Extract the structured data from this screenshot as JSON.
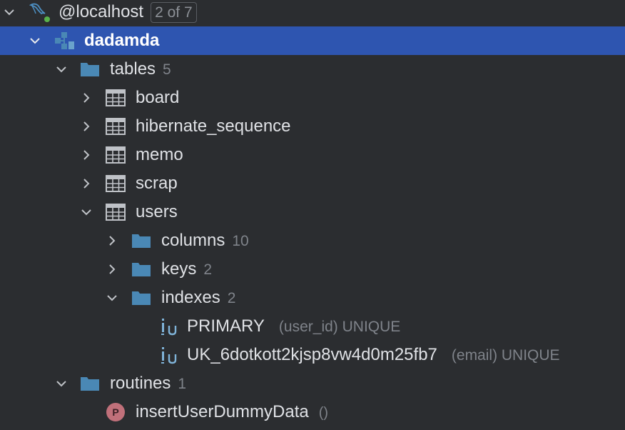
{
  "colors": {
    "background": "#2b2d30",
    "selection": "#2e55b0",
    "folder": "#4a88b5",
    "procedure": "#c0707a",
    "text": "#dfe1e5",
    "muted": "#7f838a"
  },
  "tree": {
    "host": {
      "label": "@localhost",
      "badge": "2 of 7",
      "icon": "mysql-dolphin-icon"
    },
    "schema": {
      "label": "dadamda",
      "icon": "schema-icon"
    },
    "tables": {
      "label": "tables",
      "count": "5",
      "icon": "folder-icon",
      "items": [
        {
          "label": "board",
          "icon": "table-icon"
        },
        {
          "label": "hibernate_sequence",
          "icon": "table-icon"
        },
        {
          "label": "memo",
          "icon": "table-icon"
        },
        {
          "label": "scrap",
          "icon": "table-icon"
        },
        {
          "label": "users",
          "icon": "table-icon"
        }
      ]
    },
    "users_children": {
      "columns": {
        "label": "columns",
        "count": "10"
      },
      "keys": {
        "label": "keys",
        "count": "2"
      },
      "indexes": {
        "label": "indexes",
        "count": "2"
      }
    },
    "indexes": [
      {
        "label": "PRIMARY",
        "meta": "(user_id) UNIQUE",
        "icon": "unique-index-icon"
      },
      {
        "label": "UK_6dotkott2kjsp8vw4d0m25fb7",
        "meta": "(email) UNIQUE",
        "icon": "unique-index-icon"
      }
    ],
    "routines": {
      "label": "routines",
      "count": "1",
      "items": [
        {
          "label": "insertUserDummyData",
          "params": "()",
          "icon_letter": "P",
          "icon": "procedure-icon"
        }
      ]
    }
  }
}
